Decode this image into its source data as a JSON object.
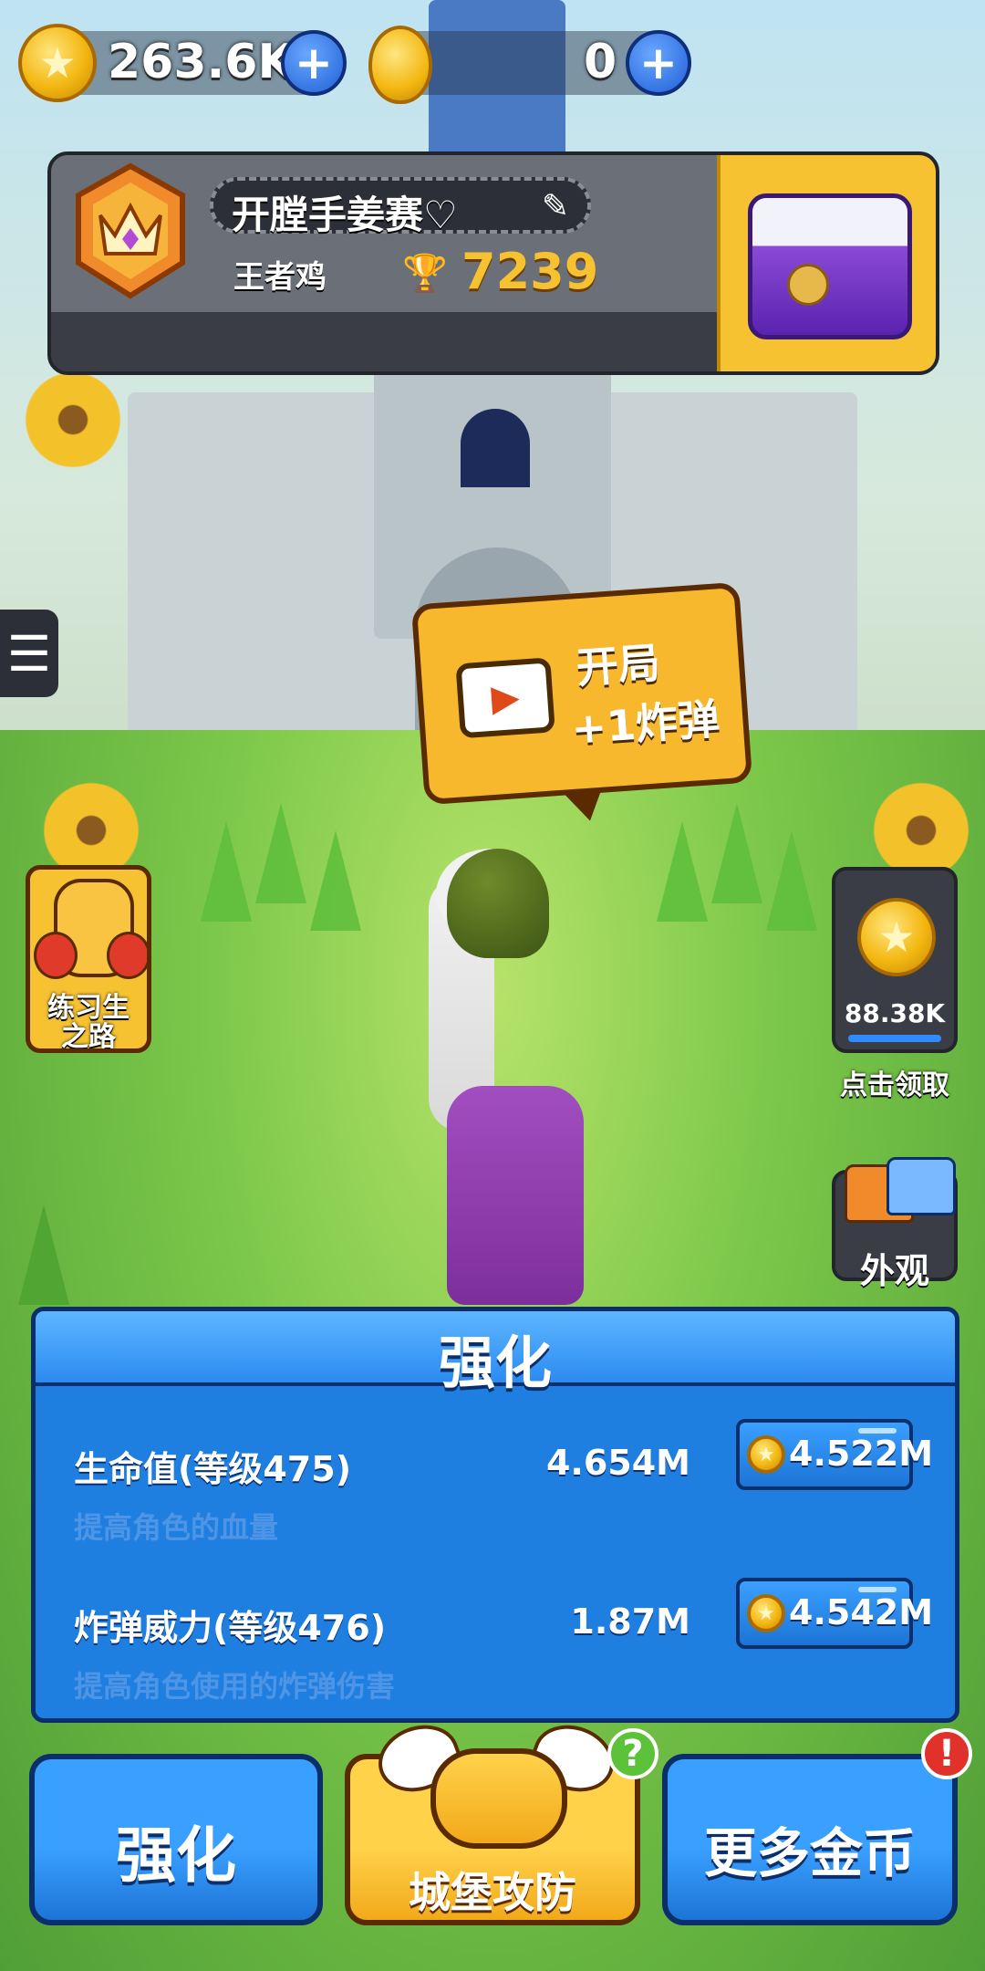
{
  "currency": {
    "coins": "263.6K",
    "gems": "0"
  },
  "profile": {
    "name": "开膛手姜赛♡",
    "rank": "王者鸡",
    "trophies": "7239"
  },
  "promo": {
    "line1": "开局",
    "line2": "+1炸弹"
  },
  "side": {
    "trainee_label_1": "练习生",
    "trainee_label_2": "之路",
    "claim_amount": "88.38K",
    "claim_label": "点击领取",
    "appearance_label": "外观"
  },
  "upgrade": {
    "title": "强化",
    "rows": [
      {
        "name": "生命值(等级475)",
        "desc": "提高角色的血量",
        "value": "4.654M",
        "cost": "4.522M"
      },
      {
        "name": "炸弹威力(等级476)",
        "desc": "提高角色使用的炸弹伤害",
        "value": "1.87M",
        "cost": "4.542M"
      }
    ]
  },
  "bottom": {
    "left": "强化",
    "center": "城堡攻防",
    "right": "更多金币",
    "center_badge": "?",
    "right_badge": "!"
  },
  "colors": {
    "accent_yellow": "#f6c232",
    "accent_blue": "#1f7fe0",
    "panel_dark": "#3a3d46"
  },
  "icons": [
    "star-coin-icon",
    "plus-icon",
    "gem-egg-icon",
    "crown-badge-icon",
    "edit-pencil-icon",
    "trophy-icon",
    "treasure-chest-icon",
    "menu-icon",
    "video-play-icon",
    "trainee-chicken-icon",
    "clothes-icon",
    "gamepad-icon",
    "question-icon",
    "exclamation-icon"
  ]
}
